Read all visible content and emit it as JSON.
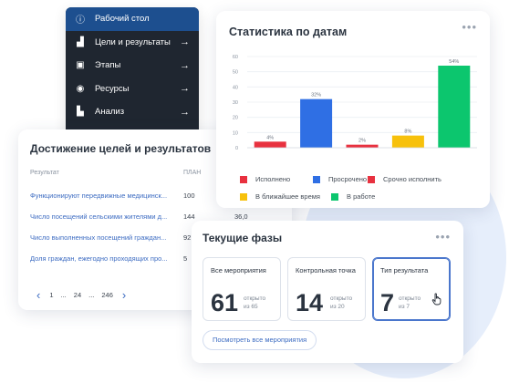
{
  "sidebar": {
    "items": [
      {
        "label": "Рабочий стол",
        "icon": "info-icon",
        "glyph": "ⓘ",
        "active": true,
        "arrow": ""
      },
      {
        "label": "Цели и результаты",
        "icon": "chart-bars-icon",
        "glyph": "▟",
        "active": false,
        "arrow": "→"
      },
      {
        "label": "Этапы",
        "icon": "briefcase-icon",
        "glyph": "▣",
        "active": false,
        "arrow": "→"
      },
      {
        "label": "Ресурсы",
        "icon": "coins-icon",
        "glyph": "◉",
        "active": false,
        "arrow": "→"
      },
      {
        "label": "Анализ",
        "icon": "analysis-icon",
        "glyph": "▙",
        "active": false,
        "arrow": "→"
      }
    ]
  },
  "stats": {
    "title": "Статистика по датам",
    "menu_icon": "kebab-icon",
    "menu_glyph": "•••"
  },
  "chart_data": {
    "type": "bar",
    "title": "Статистика по датам",
    "ylim": [
      0,
      60
    ],
    "yticks": [
      0,
      10,
      20,
      30,
      40,
      50,
      60
    ],
    "grid": true,
    "legend_position": "bottom",
    "categories": [
      "Исполнено",
      "Просрочено",
      "Срочно исполнить",
      "В ближайшее время",
      "В работе"
    ],
    "values": [
      4,
      32,
      2,
      8,
      54
    ],
    "value_labels": [
      "4%",
      "32%",
      "2%",
      "8%",
      "54%"
    ],
    "colors": [
      "#e8313f",
      "#2f6fe4",
      "#e8313f",
      "#f7c10c",
      "#0cc66e"
    ]
  },
  "goals": {
    "title": "Достижение целей и результатов",
    "col_result": "Результат",
    "col_plan": "ПЛАН",
    "rows": [
      {
        "name": "Функционируют передвижные медицинск...",
        "plan": "100",
        "extra": ""
      },
      {
        "name": "Число посещений сельскими жителями д...",
        "plan": "144",
        "extra": "36,0"
      },
      {
        "name": "Число выполненных посещений граждан...",
        "plan": "92",
        "extra": ""
      },
      {
        "name": "Доля граждан, ежегодно проходящих про...",
        "plan": "5",
        "extra": ""
      }
    ],
    "pager": {
      "prev": "‹",
      "p1": "1",
      "dots1": "...",
      "p2": "24",
      "dots2": "...",
      "p3": "246",
      "next": "›"
    }
  },
  "phases": {
    "title": "Текущие фазы",
    "menu_glyph": "•••",
    "boxes": [
      {
        "title": "Все мероприятия",
        "num": "61",
        "sub1": "открыто",
        "sub2": "из 65",
        "selected": false
      },
      {
        "title": "Контрольная точка",
        "num": "14",
        "sub1": "открыто",
        "sub2": "из 20",
        "selected": false
      },
      {
        "title": "Тип результата",
        "num": "7",
        "sub1": "открыто",
        "sub2": "из 7",
        "selected": true
      }
    ],
    "link": "Посмотреть все мероприятия"
  }
}
